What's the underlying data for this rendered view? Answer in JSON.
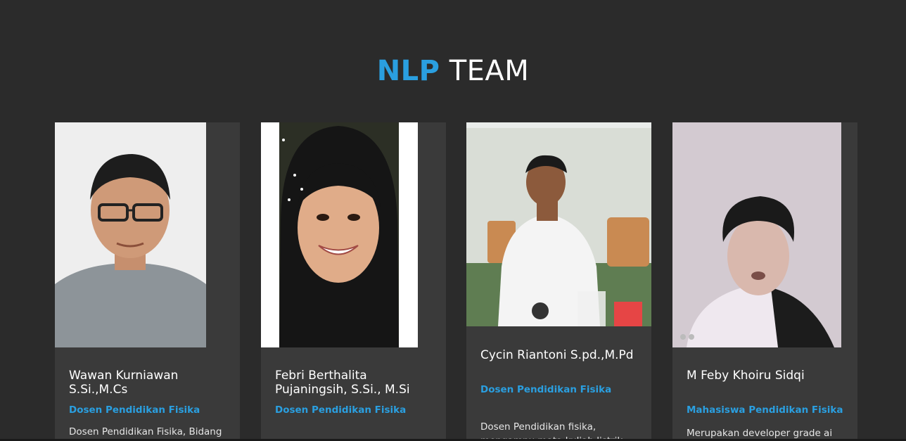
{
  "header": {
    "title_accent": "NLP",
    "title_rest": "TEAM"
  },
  "colors": {
    "background": "#2b2b2b",
    "card": "#3a3a3a",
    "accent": "#2a9fe0"
  },
  "team": [
    {
      "name": "Wawan Kurniawan S.Si.,M.Cs",
      "role": "Dosen Pendidikan Fisika",
      "description": "Dosen Pendidikan Fisika, Bidang"
    },
    {
      "name": "Febri Berthalita Pujaningsih, S.Si., M.Si",
      "role": "Dosen Pendidikan Fisika",
      "description": ""
    },
    {
      "name": "Cycin Riantoni S.pd.,M.Pd",
      "role": "Dosen Pendidikan Fisika",
      "description": "Dosen Pendidikan fisika, mengampu mata kuliah listrik"
    },
    {
      "name": "M Feby Khoiru Sidqi",
      "role": "Mahasiswa Pendidikan Fisika",
      "description": "Merupakan developer grade ai"
    }
  ]
}
